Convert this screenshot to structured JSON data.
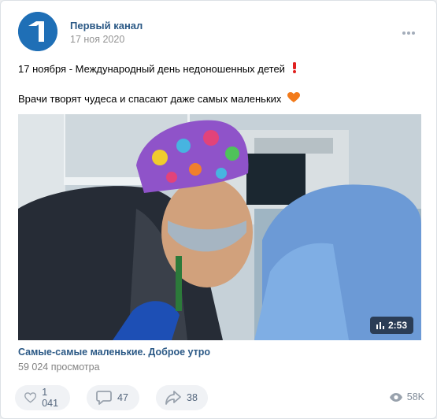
{
  "post": {
    "author": "Первый канал",
    "date": "17 ноя 2020",
    "line1": "17 ноября - Международный день недоношенных детей",
    "line1_emoji": "exclamation-emoji",
    "line2": "Врачи творят чудеса и спасают даже самых маленьких",
    "line2_emoji": "orange-heart-emoji"
  },
  "video": {
    "duration": "2:53",
    "title": "Самые-самые маленькие. Доброе утро",
    "views": "59 024 просмотра"
  },
  "actions": {
    "likes": "1 041",
    "comments": "47",
    "shares": "38",
    "views": "58K"
  },
  "colors": {
    "link": "#2a5885",
    "accent": "#1f6fb6",
    "muted": "#939393",
    "pill_bg": "#f0f2f5"
  }
}
